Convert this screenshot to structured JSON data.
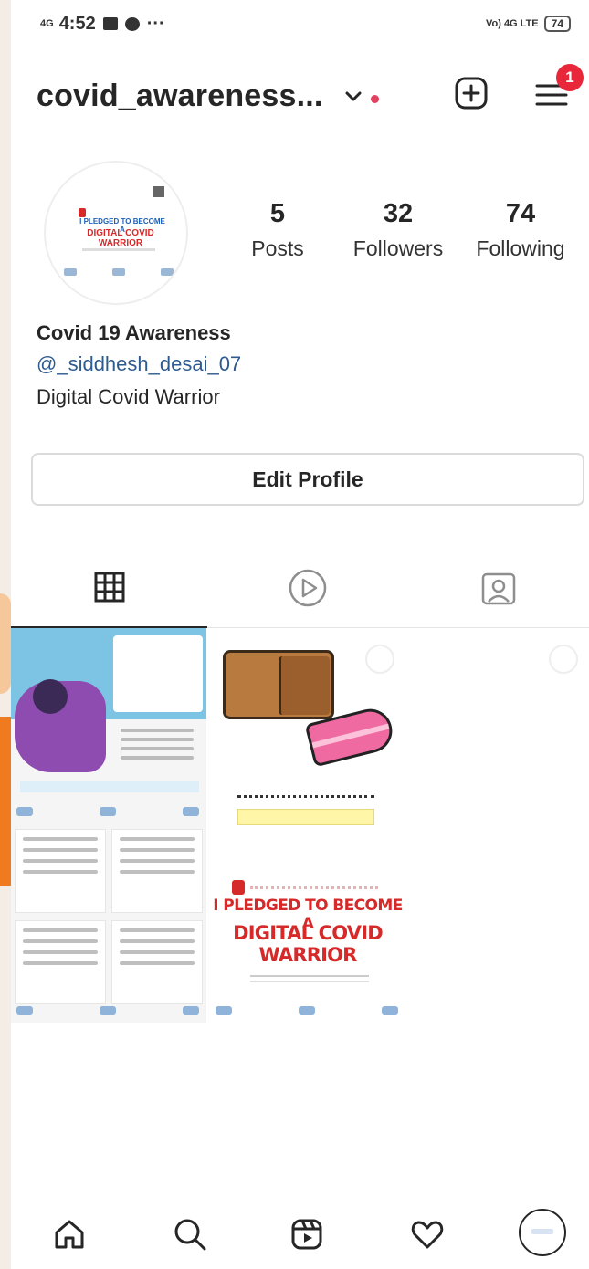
{
  "status_bar": {
    "signal": "4G",
    "time": "4:52",
    "right_label": "Vo) 4G LTE",
    "battery": "74"
  },
  "header": {
    "username": "covid_awareness...",
    "notification_count": "1"
  },
  "profile": {
    "posts_count": "5",
    "posts_label": "Posts",
    "followers_count": "32",
    "followers_label": "Followers",
    "following_count": "74",
    "following_label": "Following",
    "display_name": "Covid 19 Awareness",
    "handle": "@_siddhesh_desai_07",
    "bio": "Digital Covid Warrior",
    "avatar_line1": "I PLEDGED TO BECOME A",
    "avatar_line2": "DIGITAL COVID WARRIOR"
  },
  "edit_profile_label": "Edit Profile",
  "posts": {
    "pledge_line1": "I PLEDGED TO BECOME A",
    "pledge_line2": "DIGITAL COVID WARRIOR"
  },
  "colors": {
    "accent_red": "#d62a2a",
    "notification_red": "#e8283a",
    "link_blue": "#2e5b8f",
    "icon_dark": "#262626"
  }
}
